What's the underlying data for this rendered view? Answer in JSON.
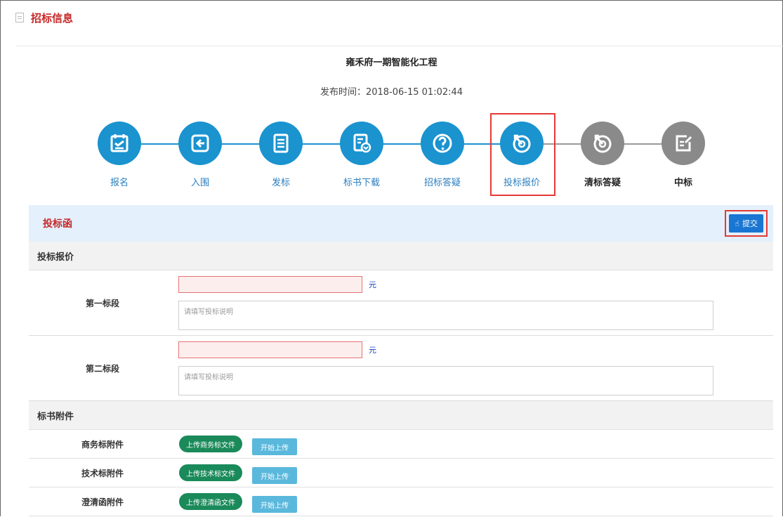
{
  "header": {
    "title": "招标信息"
  },
  "project": {
    "title": "雍禾府一期智能化工程",
    "publish_label": "发布时间：",
    "publish_time": "2018-06-15 01:02:44"
  },
  "steps": [
    {
      "label": "报名",
      "icon": "calendar-icon",
      "state": "done"
    },
    {
      "label": "入围",
      "icon": "enter-icon",
      "state": "done"
    },
    {
      "label": "发标",
      "icon": "document-icon",
      "state": "done"
    },
    {
      "label": "标书下载",
      "icon": "download-doc-icon",
      "state": "done"
    },
    {
      "label": "招标答疑",
      "icon": "question-icon",
      "state": "done"
    },
    {
      "label": "投标报价",
      "icon": "bid-quote-icon",
      "state": "current"
    },
    {
      "label": "清标答疑",
      "icon": "bid-quote-icon",
      "state": "todo"
    },
    {
      "label": "中标",
      "icon": "edit-icon",
      "state": "todo"
    }
  ],
  "colors": {
    "accent": "#1a93cf",
    "inactive": "#8a8a8a",
    "title_red": "#c62828",
    "highlight": "#e53935"
  },
  "form": {
    "title": "投标函",
    "submit_label": "提交",
    "quote_section": "投标报价",
    "stages": [
      {
        "label": "第一标段",
        "unit": "元",
        "price": "",
        "desc_placeholder": "请填写投标说明"
      },
      {
        "label": "第二标段",
        "unit": "元",
        "price": "",
        "desc_placeholder": "请填写投标说明"
      }
    ],
    "attach_section": "标书附件",
    "attachments": [
      {
        "label": "商务标附件",
        "upload": "上传商务标文件",
        "start": "开始上传"
      },
      {
        "label": "技术标附件",
        "upload": "上传技术标文件",
        "start": "开始上传"
      },
      {
        "label": "澄清函附件",
        "upload": "上传澄清函文件",
        "start": "开始上传"
      }
    ]
  }
}
